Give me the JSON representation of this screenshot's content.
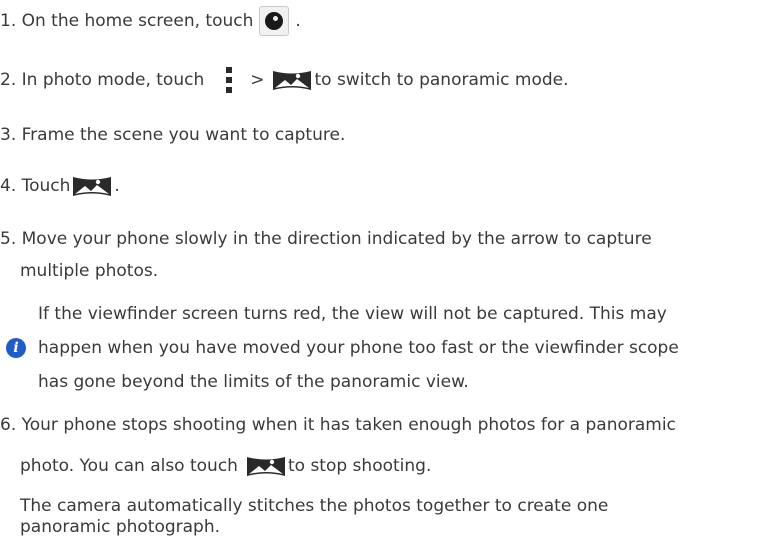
{
  "steps": {
    "s1": {
      "prefix": "1. On the home screen, touch",
      "suffix": ".",
      "icon": "camera-app-icon"
    },
    "s2": {
      "prefix": "2. In photo mode, touch",
      "sep": ">",
      "suffix": "to switch to panoramic mode.",
      "icons": [
        "menu-dots-icon",
        "panorama-mode-icon"
      ]
    },
    "s3": {
      "text": "3. Frame the scene you want to capture."
    },
    "s4": {
      "prefix": "4. Touch",
      "suffix": ".",
      "icon": "panorama-shutter-icon"
    },
    "s5": {
      "line1": "5. Move your phone slowly in the direction indicated by the arrow to capture",
      "line2": "multiple photos."
    },
    "note": {
      "icon": "info-icon",
      "line1": "If the viewfinder screen turns red, the view will not be captured. This may",
      "line2": "happen when you have moved your phone too fast or the viewfinder scope",
      "line3": "has gone beyond the limits of the panoramic view."
    },
    "s6": {
      "line1": "6. Your phone stops shooting when it has taken enough photos for a panoramic",
      "line2_prefix": "photo. You can also touch",
      "line2_suffix": "to stop shooting.",
      "icon": "panorama-stop-icon"
    },
    "closing": {
      "line1": "The camera automatically stitches the photos together to create one",
      "line2": "panoramic photograph."
    }
  },
  "colors": {
    "text": "#3a3a3a",
    "info_icon": "#1e5cc8"
  }
}
